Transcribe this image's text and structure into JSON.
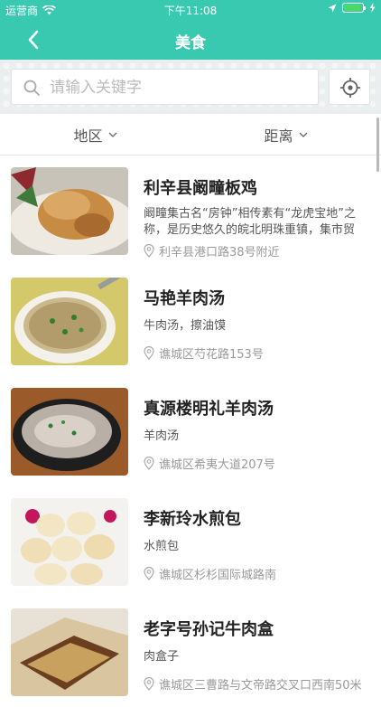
{
  "status": {
    "carrier": "运营商",
    "time": "下午11:08"
  },
  "nav": {
    "title": "美食"
  },
  "search": {
    "placeholder": "请输入关键字"
  },
  "filters": {
    "region": "地区",
    "distance": "距离"
  },
  "restaurants": [
    {
      "name": "利辛县阚疃板鸡",
      "desc": "阚疃集古名“房钟”相传素有“龙虎宝地”之称，是历史悠久的皖北明珠重镇，集市贸易…",
      "address": "利辛县港口路38号附近"
    },
    {
      "name": "马艳羊肉汤",
      "desc": "牛肉汤，擦油馍",
      "address": "谯城区芍花路153号"
    },
    {
      "name": "真源楼明礼羊肉汤",
      "desc": "羊肉汤",
      "address": "谯城区希夷大道207号"
    },
    {
      "name": "李新玲水煎包",
      "desc": "水煎包",
      "address": "谯城区杉杉国际城路南"
    },
    {
      "name": "老字号孙记牛肉盒",
      "desc": "肉盒子",
      "address": "谯城区三曹路与文帝路交叉口西南50米"
    }
  ],
  "colors": {
    "header": "#38c9b0",
    "battery": "#4cd964"
  },
  "icons": {
    "back": "chevron-left-icon",
    "search": "search-icon",
    "locate": "crosshair-icon",
    "pin": "map-pin-icon",
    "chevron": "chevron-down-icon"
  }
}
